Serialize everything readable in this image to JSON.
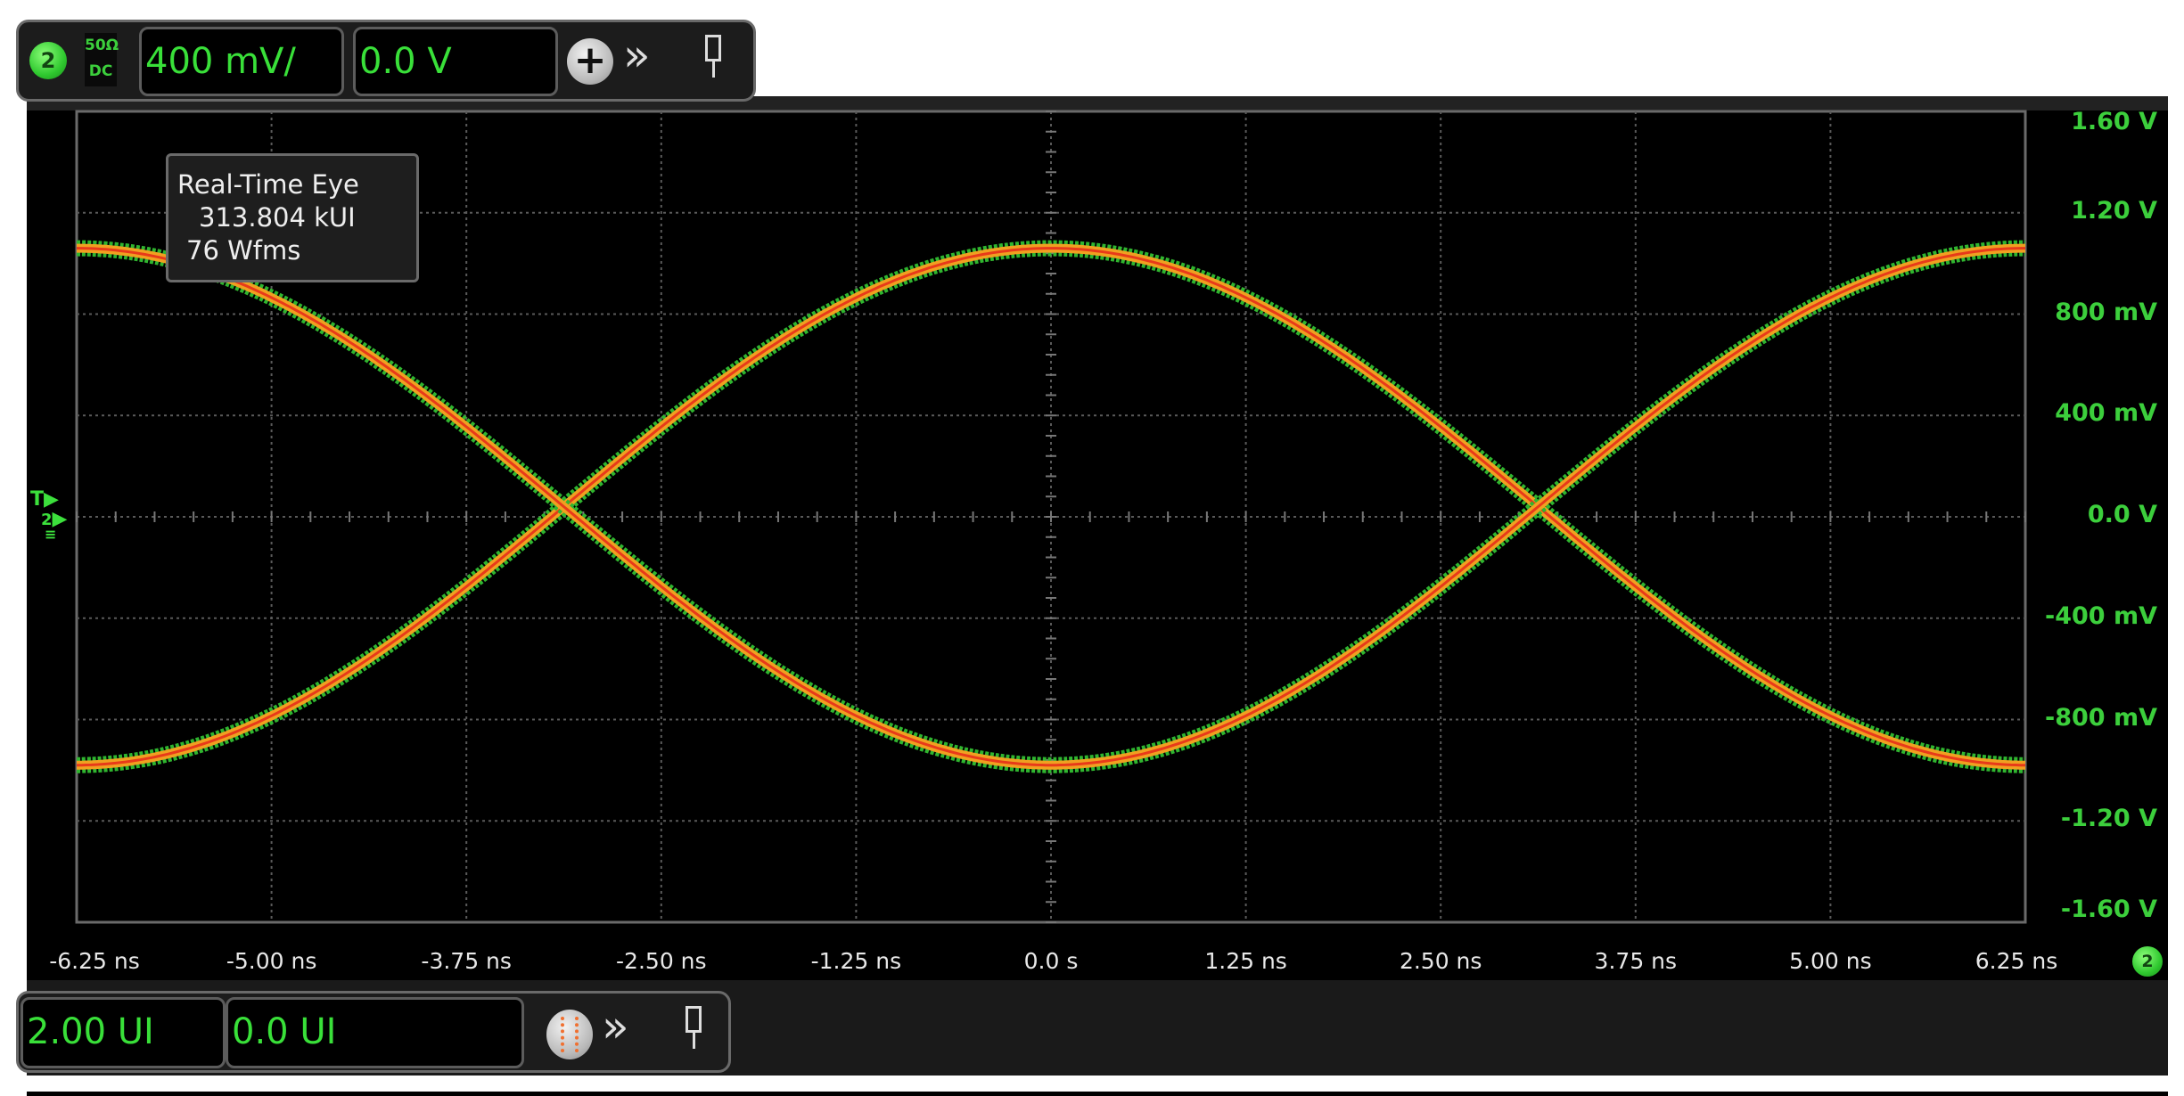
{
  "top_toolbar": {
    "channel_number": "2",
    "impedance": "50Ω",
    "coupling": "DC",
    "vertical_scale": "400 mV/",
    "vertical_offset": "0.0 V",
    "icons": [
      "add-icon",
      "expand-chevron-icon",
      "pin-icon"
    ]
  },
  "bottom_toolbar": {
    "horizontal_scale": "2.00 UI",
    "horizontal_position": "0.0 UI",
    "icons": [
      "eye-mode-icon",
      "expand-chevron-icon",
      "pin-icon"
    ]
  },
  "info_box": {
    "title": "Real-Time Eye",
    "ui_count": "313.804 kUI",
    "waveforms": "76 Wfms"
  },
  "trigger_marker": {
    "label": "T",
    "ground_label": "2"
  },
  "channel_badge": "2",
  "colors": {
    "trace_outer": "#2fb52f",
    "trace_mid": "#f0a020",
    "trace_core": "#e83a1a",
    "label_green": "#3ccf3c",
    "grid": "#5a5a5a"
  },
  "chart_data": {
    "type": "line",
    "title": "Real-Time Eye",
    "xlabel": "",
    "ylabel": "",
    "xlim": [
      -6.25,
      6.25
    ],
    "ylim": [
      -1.6,
      1.6
    ],
    "grid": true,
    "x_ticks": [
      "-6.25 ns",
      "-5.00 ns",
      "-3.75 ns",
      "-2.50 ns",
      "-1.25 ns",
      "0.0 s",
      "1.25 ns",
      "2.50 ns",
      "3.75 ns",
      "5.00 ns",
      "6.25 ns"
    ],
    "x_tick_values": [
      -6.25,
      -5,
      -3.75,
      -2.5,
      -1.25,
      0,
      1.25,
      2.5,
      3.75,
      5,
      6.25
    ],
    "y_ticks": [
      "1.60 V",
      "1.20 V",
      "800 mV",
      "400 mV",
      "0.0 V",
      "-400 mV",
      "-800 mV",
      "-1.20 V",
      "-1.60 V"
    ],
    "y_tick_values": [
      1.6,
      1.2,
      0.8,
      0.4,
      0,
      -0.4,
      -0.8,
      -1.2,
      -1.6
    ],
    "series": [
      {
        "name": "rising-falling eye trace A",
        "shape": "cosine",
        "period_ns": 12.5,
        "amplitude_v": 1.02,
        "offset_v": 0.04,
        "phase": "peak at 0 ns"
      },
      {
        "name": "eye trace B",
        "shape": "cosine",
        "period_ns": 12.5,
        "amplitude_v": -1.02,
        "offset_v": 0.04,
        "phase": "trough at 0 ns"
      }
    ],
    "crossings_ns": [
      -3.125,
      3.125
    ]
  }
}
